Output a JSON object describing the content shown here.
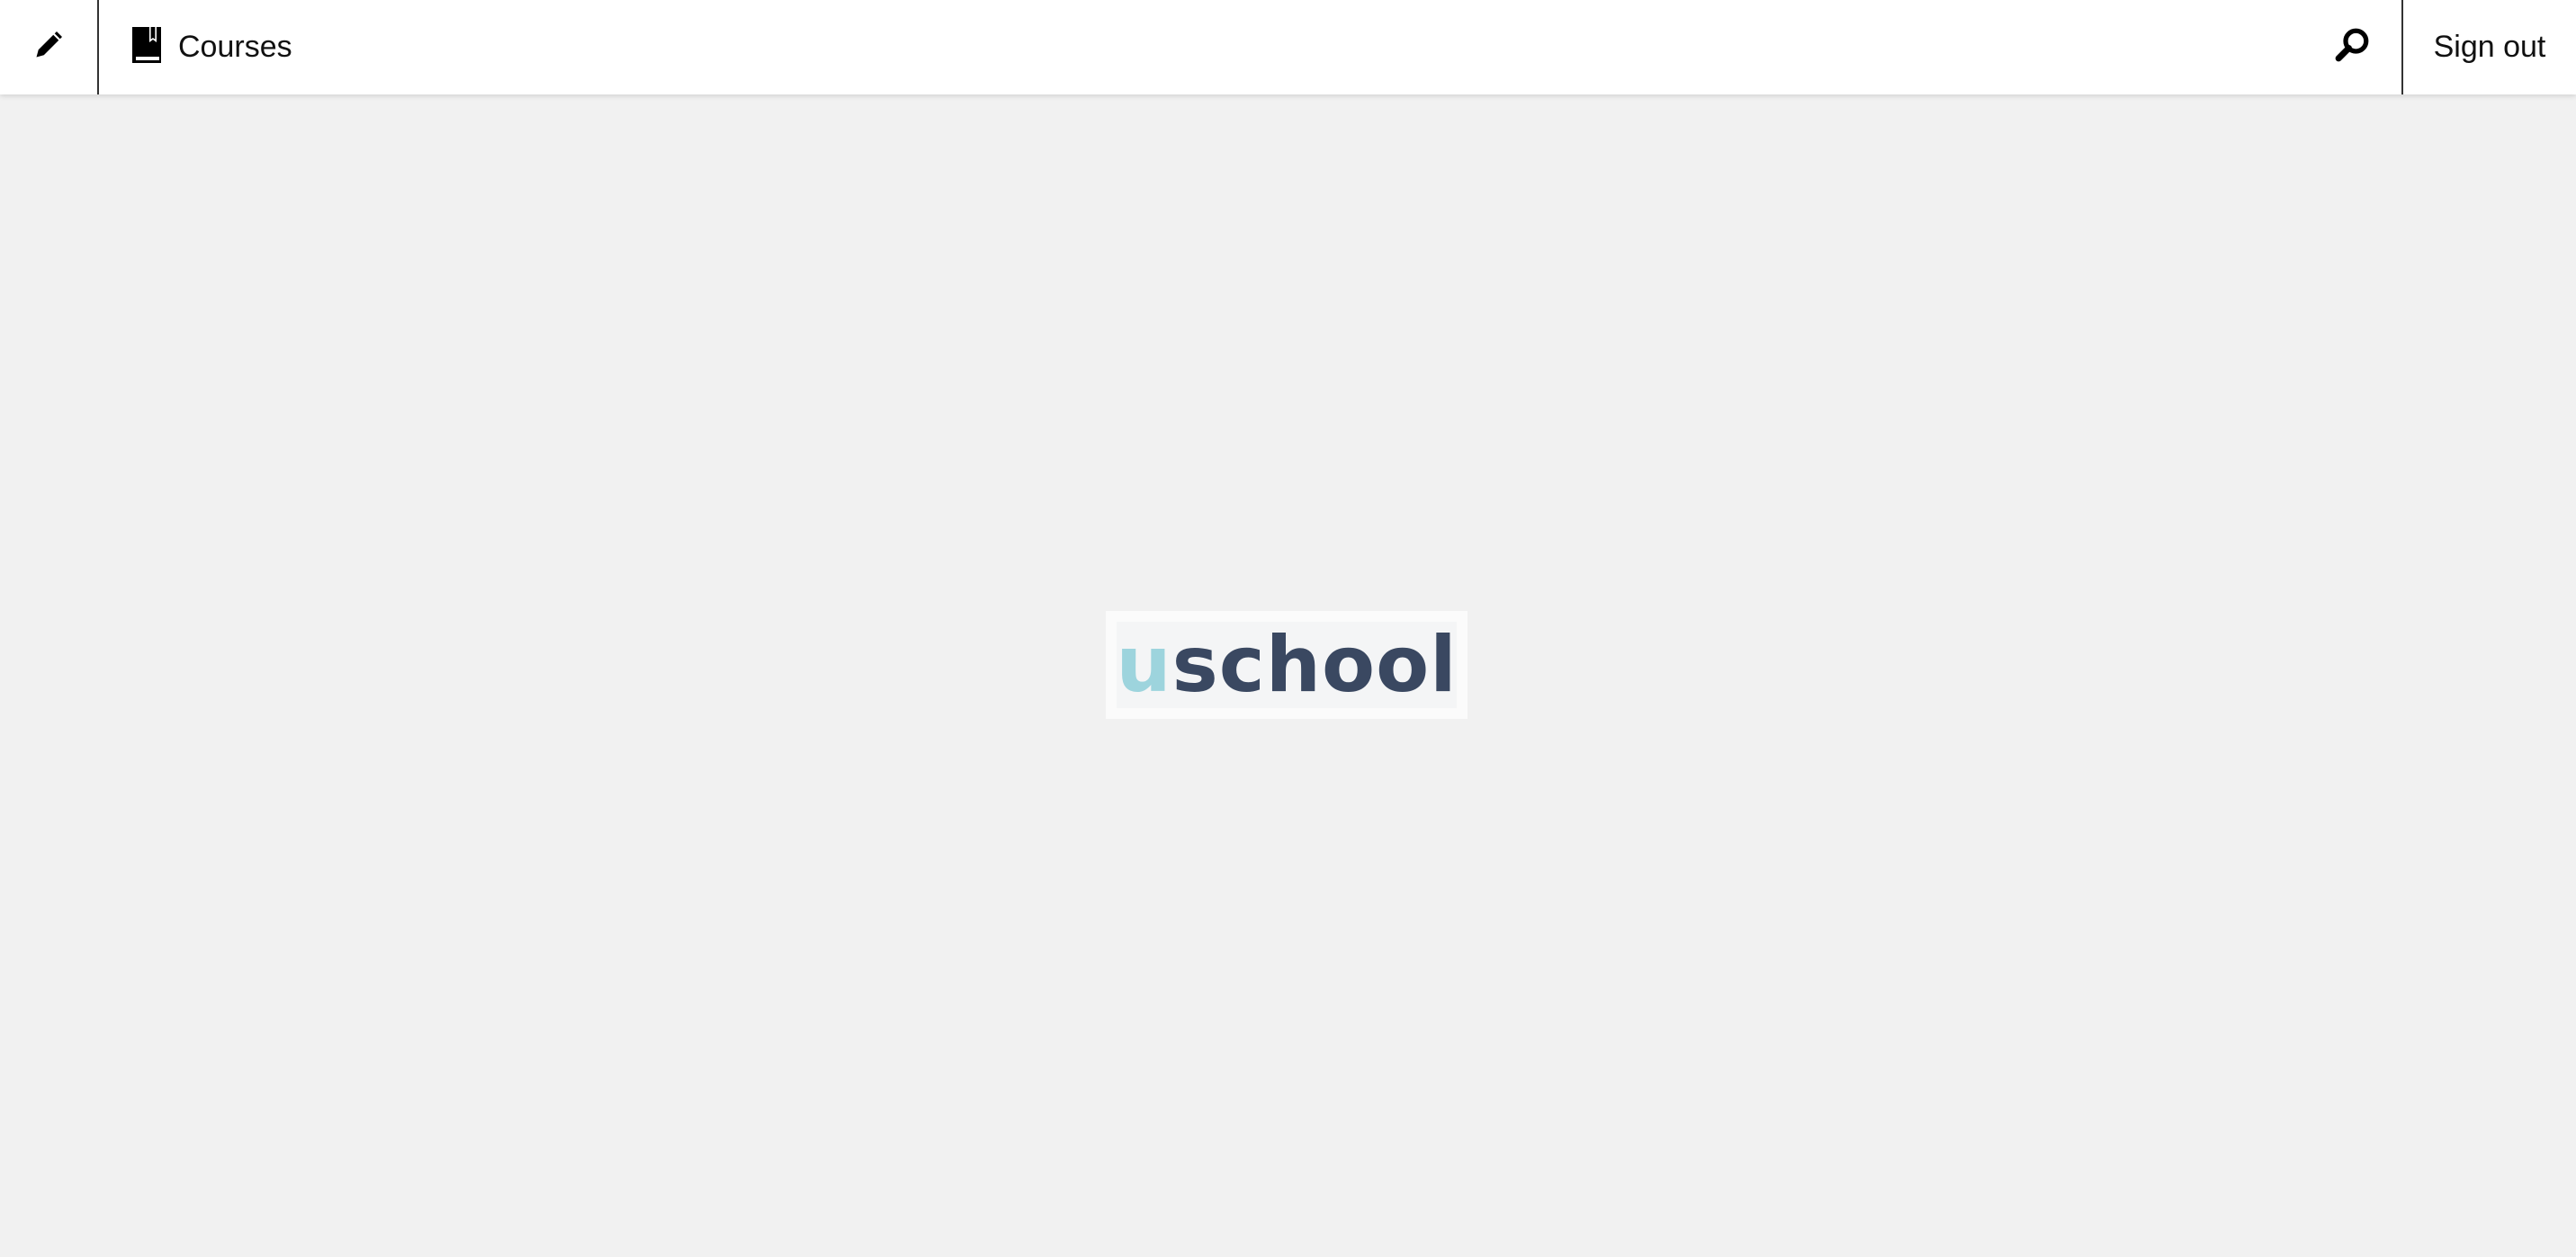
{
  "header": {
    "edit_icon": "pencil-icon",
    "courses_icon": "book-icon",
    "courses_label": "Courses",
    "search_icon": "search-icon",
    "signout_label": "Sign out"
  },
  "logo": {
    "text_first": "u",
    "text_rest": "school",
    "colors": {
      "accent": "#9dd4dd",
      "primary": "#3a4861"
    }
  },
  "colors": {
    "background": "#f1f1f1",
    "header_bg": "#ffffff"
  }
}
